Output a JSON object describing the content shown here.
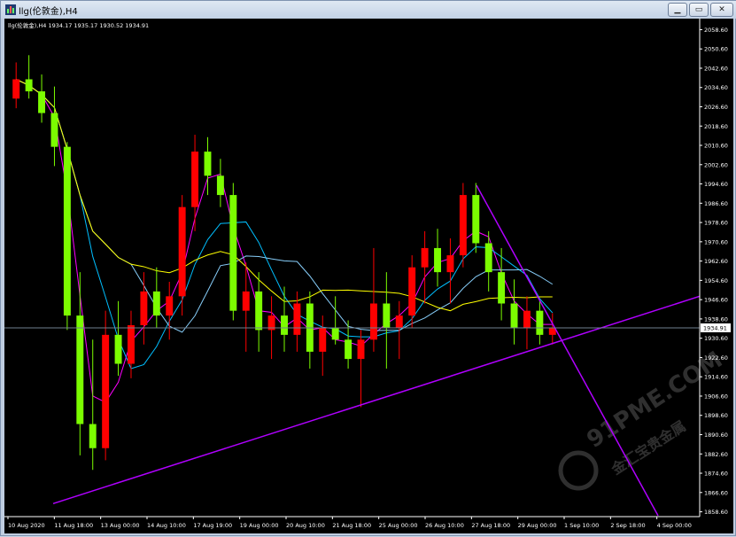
{
  "window": {
    "title": "llg(伦敦金),H4",
    "buttons": {
      "minimize": "▁",
      "restore": "▭",
      "close": "✕"
    }
  },
  "chart": {
    "info_line": "llg(伦敦金),H4  1934.17 1935.17 1930.52 1934.91",
    "current_price": "1934.91",
    "watermark": {
      "domain": "91PME.COM",
      "cn": "金汇宝贵金属"
    },
    "colors": {
      "bull": "#ff0000",
      "bear": "#7cfc00",
      "ma_fast": "#ff00ff",
      "ma_mid": "#00bfff",
      "ma_slow": "#ffff00",
      "ma_ext": "#87cefa",
      "trend": "#b000ff"
    }
  },
  "chart_data": {
    "type": "candlestick",
    "y_ticks": [
      "2058.60",
      "2050.60",
      "2042.60",
      "2034.60",
      "2026.60",
      "2018.60",
      "2010.60",
      "2002.60",
      "1994.60",
      "1986.60",
      "1978.60",
      "1970.60",
      "1962.60",
      "1954.60",
      "1946.60",
      "1938.60",
      "1930.60",
      "1922.60",
      "1914.60",
      "1906.60",
      "1898.60",
      "1890.60",
      "1882.60",
      "1874.60",
      "1866.60",
      "1858.60"
    ],
    "y_values": [
      2058.6,
      2050.6,
      2042.6,
      2034.6,
      2026.6,
      2018.6,
      2010.6,
      2002.6,
      1994.6,
      1986.6,
      1978.6,
      1970.6,
      1962.6,
      1954.6,
      1946.6,
      1938.6,
      1930.6,
      1922.6,
      1914.6,
      1906.6,
      1898.6,
      1890.6,
      1882.6,
      1874.6,
      1866.6,
      1858.6
    ],
    "ylim": [
      1856.6,
      2060.6
    ],
    "x_ticks": [
      "10 Aug 2020",
      "11 Aug 18:00",
      "13 Aug 00:00",
      "14 Aug 10:00",
      "17 Aug 19:00",
      "19 Aug 00:00",
      "20 Aug 10:00",
      "21 Aug 18:00",
      "25 Aug 00:00",
      "26 Aug 10:00",
      "27 Aug 18:00",
      "29 Aug 00:00",
      "1 Sep 10:00",
      "2 Sep 18:00",
      "4 Sep 00:00"
    ],
    "candles": [
      {
        "o": 2030,
        "h": 2045,
        "l": 2026,
        "c": 2038
      },
      {
        "o": 2038,
        "h": 2048,
        "l": 2030,
        "c": 2033
      },
      {
        "o": 2033,
        "h": 2040,
        "l": 2020,
        "c": 2024
      },
      {
        "o": 2024,
        "h": 2035,
        "l": 2002,
        "c": 2010
      },
      {
        "o": 2010,
        "h": 2012,
        "l": 1934,
        "c": 1940
      },
      {
        "o": 1940,
        "h": 1958,
        "l": 1882,
        "c": 1895
      },
      {
        "o": 1895,
        "h": 1930,
        "l": 1876,
        "c": 1885
      },
      {
        "o": 1885,
        "h": 1942,
        "l": 1880,
        "c": 1932
      },
      {
        "o": 1932,
        "h": 1946,
        "l": 1915,
        "c": 1920
      },
      {
        "o": 1920,
        "h": 1942,
        "l": 1914,
        "c": 1936
      },
      {
        "o": 1936,
        "h": 1958,
        "l": 1928,
        "c": 1950
      },
      {
        "o": 1950,
        "h": 1960,
        "l": 1935,
        "c": 1940
      },
      {
        "o": 1940,
        "h": 1954,
        "l": 1930,
        "c": 1948
      },
      {
        "o": 1948,
        "h": 1990,
        "l": 1940,
        "c": 1985
      },
      {
        "o": 1985,
        "h": 2015,
        "l": 1975,
        "c": 2008
      },
      {
        "o": 2008,
        "h": 2014,
        "l": 1990,
        "c": 1998
      },
      {
        "o": 1998,
        "h": 2005,
        "l": 1985,
        "c": 1990
      },
      {
        "o": 1990,
        "h": 1995,
        "l": 1938,
        "c": 1942
      },
      {
        "o": 1942,
        "h": 1962,
        "l": 1925,
        "c": 1950
      },
      {
        "o": 1950,
        "h": 1958,
        "l": 1925,
        "c": 1934
      },
      {
        "o": 1934,
        "h": 1948,
        "l": 1922,
        "c": 1940
      },
      {
        "o": 1940,
        "h": 1952,
        "l": 1925,
        "c": 1932
      },
      {
        "o": 1932,
        "h": 1950,
        "l": 1925,
        "c": 1945
      },
      {
        "o": 1945,
        "h": 1950,
        "l": 1918,
        "c": 1925
      },
      {
        "o": 1925,
        "h": 1940,
        "l": 1915,
        "c": 1935
      },
      {
        "o": 1935,
        "h": 1948,
        "l": 1928,
        "c": 1930
      },
      {
        "o": 1930,
        "h": 1938,
        "l": 1918,
        "c": 1922
      },
      {
        "o": 1922,
        "h": 1934,
        "l": 1902,
        "c": 1930
      },
      {
        "o": 1930,
        "h": 1968,
        "l": 1925,
        "c": 1945
      },
      {
        "o": 1945,
        "h": 1958,
        "l": 1918,
        "c": 1935
      },
      {
        "o": 1935,
        "h": 1946,
        "l": 1922,
        "c": 1940
      },
      {
        "o": 1940,
        "h": 1965,
        "l": 1935,
        "c": 1960
      },
      {
        "o": 1960,
        "h": 1975,
        "l": 1945,
        "c": 1968
      },
      {
        "o": 1968,
        "h": 1976,
        "l": 1952,
        "c": 1958
      },
      {
        "o": 1958,
        "h": 1972,
        "l": 1945,
        "c": 1965
      },
      {
        "o": 1965,
        "h": 1995,
        "l": 1960,
        "c": 1990
      },
      {
        "o": 1990,
        "h": 1995,
        "l": 1966,
        "c": 1970
      },
      {
        "o": 1970,
        "h": 1975,
        "l": 1950,
        "c": 1958
      },
      {
        "o": 1958,
        "h": 1968,
        "l": 1938,
        "c": 1945
      },
      {
        "o": 1945,
        "h": 1955,
        "l": 1928,
        "c": 1935
      },
      {
        "o": 1935,
        "h": 1948,
        "l": 1926,
        "c": 1942
      },
      {
        "o": 1942,
        "h": 1946,
        "l": 1928,
        "c": 1932
      },
      {
        "o": 1932,
        "h": 1941,
        "l": 1928,
        "c": 1934.91
      }
    ]
  }
}
